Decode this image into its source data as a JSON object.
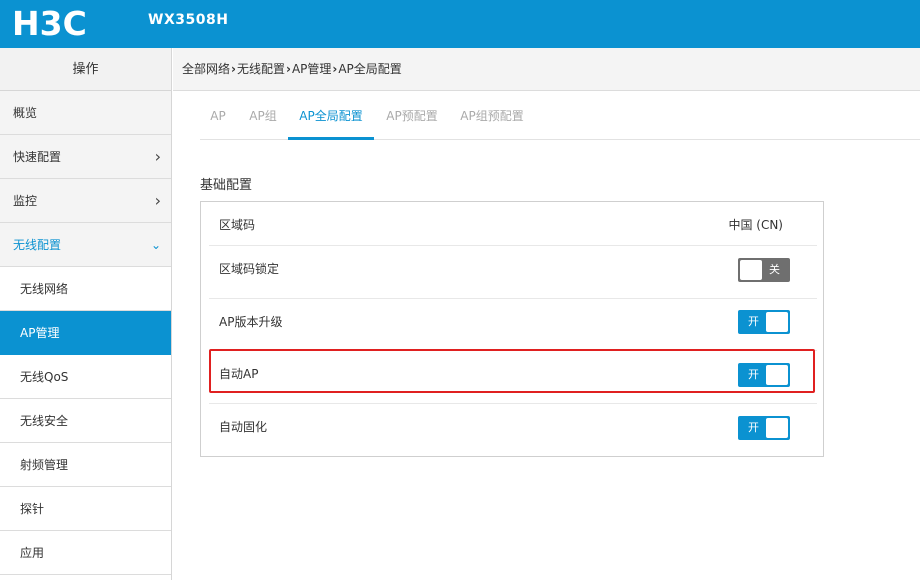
{
  "header": {
    "brand": "H3C",
    "model": "WX3508H"
  },
  "sidebar": {
    "heading": "操作",
    "items": [
      {
        "label": "概览"
      },
      {
        "label": "快速配置"
      },
      {
        "label": "监控"
      },
      {
        "label": "无线配置"
      }
    ],
    "subitems": [
      {
        "label": "无线网络"
      },
      {
        "label": "AP管理"
      },
      {
        "label": "无线QoS"
      },
      {
        "label": "无线安全"
      },
      {
        "label": "射频管理"
      },
      {
        "label": "探针"
      },
      {
        "label": "应用"
      }
    ],
    "active_subitem": "AP管理"
  },
  "breadcrumb": [
    "全部网络",
    "无线配置",
    "AP管理",
    "AP全局配置"
  ],
  "tabs": [
    {
      "label": "AP"
    },
    {
      "label": "AP组"
    },
    {
      "label": "AP全局配置"
    },
    {
      "label": "AP预配置"
    },
    {
      "label": "AP组预配置"
    }
  ],
  "active_tab": "AP全局配置",
  "section": {
    "title": "基础配置",
    "rows": [
      {
        "label": "区域码",
        "value": "中国 (CN)"
      },
      {
        "label": "区域码锁定",
        "toggle": "关",
        "state": "off"
      },
      {
        "label": "AP版本升级",
        "toggle": "开",
        "state": "on"
      },
      {
        "label": "自动AP",
        "toggle": "开",
        "state": "on"
      },
      {
        "label": "自动固化",
        "toggle": "开",
        "state": "on"
      }
    ]
  },
  "colors": {
    "brand_blue": "#0b92d1",
    "highlight_red": "#e02020",
    "toggle_off": "#6f6f6f"
  }
}
